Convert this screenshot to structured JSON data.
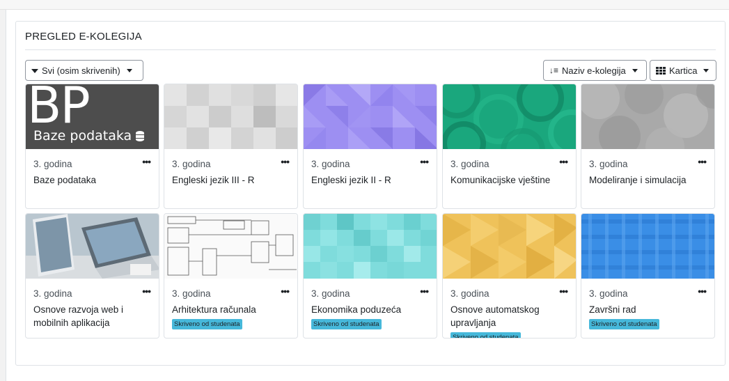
{
  "panel": {
    "title": "PREGLED E-KOLEGIJA"
  },
  "toolbar": {
    "filter_label": "Svi (osim skrivenih)",
    "sort_label": "Naziv e-kolegija",
    "view_label": "Kartica"
  },
  "courses": [
    {
      "category": "3. godina",
      "name": "Baze podataka",
      "image_title": "BP",
      "image_subtitle": "Baze podataka",
      "badge": ""
    },
    {
      "category": "3. godina",
      "name": "Engleski jezik III - R",
      "badge": ""
    },
    {
      "category": "3. godina",
      "name": "Engleski jezik II - R",
      "badge": ""
    },
    {
      "category": "3. godina",
      "name": "Komunikacijske vještine",
      "badge": ""
    },
    {
      "category": "3. godina",
      "name": "Modeliranje i simulacija",
      "badge": ""
    },
    {
      "category": "3. godina",
      "name": "Osnove razvoja web i mobilnih aplikacija",
      "badge": ""
    },
    {
      "category": "3. godina",
      "name": "Arhitektura računala",
      "badge": "Skriveno od studenata"
    },
    {
      "category": "3. godina",
      "name": "Ekonomika poduzeća",
      "badge": "Skriveno od studenata"
    },
    {
      "category": "3. godina",
      "name": "Osnove automatskog upravljanja",
      "badge": "Skriveno od studenata"
    },
    {
      "category": "3. godina",
      "name": "Završni rad",
      "badge": "Skriveno od studenata"
    }
  ],
  "icons": {
    "filter": "filter-icon",
    "sort": "sort-alpha-icon",
    "view": "grid-icon",
    "card_menu": "more-dots-icon",
    "database": "database-icon"
  },
  "colors": {
    "badge": "#46b8da",
    "bp_background": "#4d4d4d",
    "grey_pattern": "#d4d4d4",
    "purple_pattern": "#9d8ff2",
    "green_pattern": "#1aa77d",
    "silver_pattern": "#a9a9a9",
    "cyan_pattern": "#7fdcdc",
    "gold_pattern": "#efc25a",
    "blue_pattern": "#3a8ee6"
  }
}
